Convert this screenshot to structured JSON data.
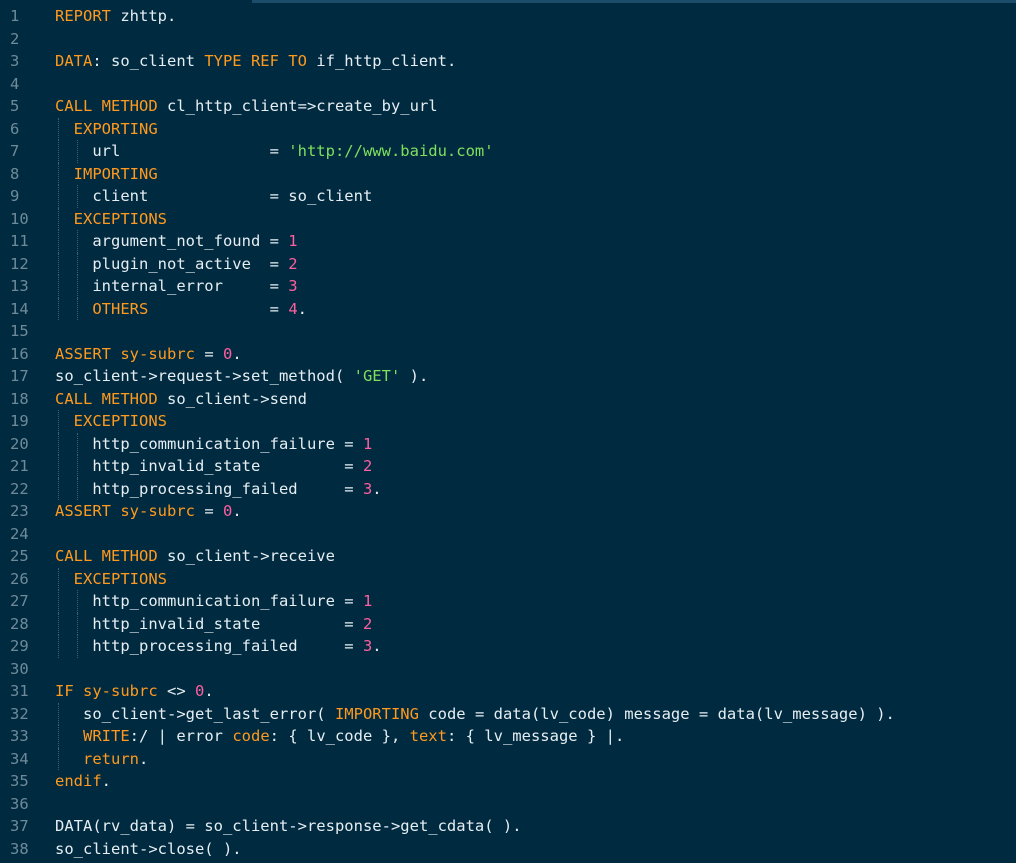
{
  "editor": {
    "language": "ABAP",
    "colors": {
      "background": "#002a40",
      "keyword": "#ff9a1f",
      "string": "#7fe05e",
      "number": "#ff5fa0",
      "identifier": "#e6eef2",
      "line_number": "#6f8b99"
    },
    "lines": [
      {
        "n": "1",
        "guides": [],
        "tokens": [
          {
            "t": "REPORT",
            "c": "kw"
          },
          {
            "t": " zhttp.",
            "c": "id"
          }
        ]
      },
      {
        "n": "2",
        "guides": [],
        "tokens": []
      },
      {
        "n": "3",
        "guides": [],
        "tokens": [
          {
            "t": "DATA",
            "c": "kw"
          },
          {
            "t": ": so_client ",
            "c": "id"
          },
          {
            "t": "TYPE REF TO",
            "c": "kw"
          },
          {
            "t": " if_http_client.",
            "c": "id"
          }
        ]
      },
      {
        "n": "4",
        "guides": [],
        "tokens": []
      },
      {
        "n": "5",
        "guides": [],
        "tokens": [
          {
            "t": "CALL METHOD",
            "c": "kw"
          },
          {
            "t": " cl_http_client=>create_by_url",
            "c": "id"
          }
        ]
      },
      {
        "n": "6",
        "guides": [
          0
        ],
        "tokens": [
          {
            "t": "  ",
            "c": "id"
          },
          {
            "t": "EXPORTING",
            "c": "kw"
          }
        ]
      },
      {
        "n": "7",
        "guides": [
          0,
          2
        ],
        "tokens": [
          {
            "t": "    url                = ",
            "c": "id"
          },
          {
            "t": "'http://www.baidu.com'",
            "c": "str"
          }
        ]
      },
      {
        "n": "8",
        "guides": [
          0
        ],
        "tokens": [
          {
            "t": "  ",
            "c": "id"
          },
          {
            "t": "IMPORTING",
            "c": "kw"
          }
        ]
      },
      {
        "n": "9",
        "guides": [
          0,
          2
        ],
        "tokens": [
          {
            "t": "    client             = so_client",
            "c": "id"
          }
        ]
      },
      {
        "n": "10",
        "guides": [
          0
        ],
        "tokens": [
          {
            "t": "  ",
            "c": "id"
          },
          {
            "t": "EXCEPTIONS",
            "c": "kw"
          }
        ]
      },
      {
        "n": "11",
        "guides": [
          0,
          2
        ],
        "tokens": [
          {
            "t": "    argument_not_found = ",
            "c": "id"
          },
          {
            "t": "1",
            "c": "num"
          }
        ]
      },
      {
        "n": "12",
        "guides": [
          0,
          2
        ],
        "tokens": [
          {
            "t": "    plugin_not_active  = ",
            "c": "id"
          },
          {
            "t": "2",
            "c": "num"
          }
        ]
      },
      {
        "n": "13",
        "guides": [
          0,
          2
        ],
        "tokens": [
          {
            "t": "    internal_error     = ",
            "c": "id"
          },
          {
            "t": "3",
            "c": "num"
          }
        ]
      },
      {
        "n": "14",
        "guides": [
          0,
          2
        ],
        "tokens": [
          {
            "t": "    ",
            "c": "id"
          },
          {
            "t": "OTHERS",
            "c": "kw"
          },
          {
            "t": "             = ",
            "c": "id"
          },
          {
            "t": "4",
            "c": "num"
          },
          {
            "t": ".",
            "c": "id"
          }
        ]
      },
      {
        "n": "15",
        "guides": [],
        "tokens": []
      },
      {
        "n": "16",
        "guides": [],
        "tokens": [
          {
            "t": "ASSERT",
            "c": "kw"
          },
          {
            "t": " ",
            "c": "id"
          },
          {
            "t": "sy-subrc",
            "c": "kw"
          },
          {
            "t": " = ",
            "c": "id"
          },
          {
            "t": "0",
            "c": "num"
          },
          {
            "t": ".",
            "c": "id"
          }
        ]
      },
      {
        "n": "17",
        "guides": [],
        "tokens": [
          {
            "t": "so_client->request->set_method( ",
            "c": "id"
          },
          {
            "t": "'GET'",
            "c": "str"
          },
          {
            "t": " ).",
            "c": "id"
          }
        ]
      },
      {
        "n": "18",
        "guides": [],
        "tokens": [
          {
            "t": "CALL METHOD",
            "c": "kw"
          },
          {
            "t": " so_client->send",
            "c": "id"
          }
        ]
      },
      {
        "n": "19",
        "guides": [
          0
        ],
        "tokens": [
          {
            "t": "  ",
            "c": "id"
          },
          {
            "t": "EXCEPTIONS",
            "c": "kw"
          }
        ]
      },
      {
        "n": "20",
        "guides": [
          0,
          2
        ],
        "tokens": [
          {
            "t": "    http_communication_failure = ",
            "c": "id"
          },
          {
            "t": "1",
            "c": "num"
          }
        ]
      },
      {
        "n": "21",
        "guides": [
          0,
          2
        ],
        "tokens": [
          {
            "t": "    http_invalid_state         = ",
            "c": "id"
          },
          {
            "t": "2",
            "c": "num"
          }
        ]
      },
      {
        "n": "22",
        "guides": [
          0,
          2
        ],
        "tokens": [
          {
            "t": "    http_processing_failed     = ",
            "c": "id"
          },
          {
            "t": "3",
            "c": "num"
          },
          {
            "t": ".",
            "c": "id"
          }
        ]
      },
      {
        "n": "23",
        "guides": [],
        "tokens": [
          {
            "t": "ASSERT",
            "c": "kw"
          },
          {
            "t": " ",
            "c": "id"
          },
          {
            "t": "sy-subrc",
            "c": "kw"
          },
          {
            "t": " = ",
            "c": "id"
          },
          {
            "t": "0",
            "c": "num"
          },
          {
            "t": ".",
            "c": "id"
          }
        ]
      },
      {
        "n": "24",
        "guides": [],
        "tokens": []
      },
      {
        "n": "25",
        "guides": [],
        "tokens": [
          {
            "t": "CALL METHOD",
            "c": "kw"
          },
          {
            "t": " so_client->receive",
            "c": "id"
          }
        ]
      },
      {
        "n": "26",
        "guides": [
          0
        ],
        "tokens": [
          {
            "t": "  ",
            "c": "id"
          },
          {
            "t": "EXCEPTIONS",
            "c": "kw"
          }
        ]
      },
      {
        "n": "27",
        "guides": [
          0,
          2
        ],
        "tokens": [
          {
            "t": "    http_communication_failure = ",
            "c": "id"
          },
          {
            "t": "1",
            "c": "num"
          }
        ]
      },
      {
        "n": "28",
        "guides": [
          0,
          2
        ],
        "tokens": [
          {
            "t": "    http_invalid_state         = ",
            "c": "id"
          },
          {
            "t": "2",
            "c": "num"
          }
        ]
      },
      {
        "n": "29",
        "guides": [
          0,
          2
        ],
        "tokens": [
          {
            "t": "    http_processing_failed     = ",
            "c": "id"
          },
          {
            "t": "3",
            "c": "num"
          },
          {
            "t": ".",
            "c": "id"
          }
        ]
      },
      {
        "n": "30",
        "guides": [],
        "tokens": []
      },
      {
        "n": "31",
        "guides": [],
        "tokens": [
          {
            "t": "IF",
            "c": "kw"
          },
          {
            "t": " ",
            "c": "id"
          },
          {
            "t": "sy-subrc",
            "c": "kw"
          },
          {
            "t": " <> ",
            "c": "id"
          },
          {
            "t": "0",
            "c": "num"
          },
          {
            "t": ".",
            "c": "id"
          }
        ]
      },
      {
        "n": "32",
        "guides": [
          0
        ],
        "tokens": [
          {
            "t": "   so_client->get_last_error( ",
            "c": "id"
          },
          {
            "t": "IMPORTING",
            "c": "kw"
          },
          {
            "t": " code = data(lv_code) message = data(lv_message) ).",
            "c": "id"
          }
        ]
      },
      {
        "n": "33",
        "guides": [
          0
        ],
        "tokens": [
          {
            "t": "   ",
            "c": "id"
          },
          {
            "t": "WRITE",
            "c": "kw"
          },
          {
            "t": ":/ | error ",
            "c": "id"
          },
          {
            "t": "code",
            "c": "kw"
          },
          {
            "t": ": { lv_code }, ",
            "c": "id"
          },
          {
            "t": "text",
            "c": "kw"
          },
          {
            "t": ": { lv_message } |.",
            "c": "id"
          }
        ]
      },
      {
        "n": "34",
        "guides": [
          0
        ],
        "tokens": [
          {
            "t": "   ",
            "c": "id"
          },
          {
            "t": "return",
            "c": "kw"
          },
          {
            "t": ".",
            "c": "id"
          }
        ]
      },
      {
        "n": "35",
        "guides": [],
        "tokens": [
          {
            "t": "endif",
            "c": "kw"
          },
          {
            "t": ".",
            "c": "id"
          }
        ]
      },
      {
        "n": "36",
        "guides": [],
        "tokens": []
      },
      {
        "n": "37",
        "guides": [],
        "tokens": [
          {
            "t": "DATA(rv_data) = so_client->response->get_cdata( ).",
            "c": "id"
          }
        ]
      },
      {
        "n": "38",
        "guides": [],
        "tokens": [
          {
            "t": "so_client->close( ).",
            "c": "id"
          }
        ]
      }
    ]
  }
}
